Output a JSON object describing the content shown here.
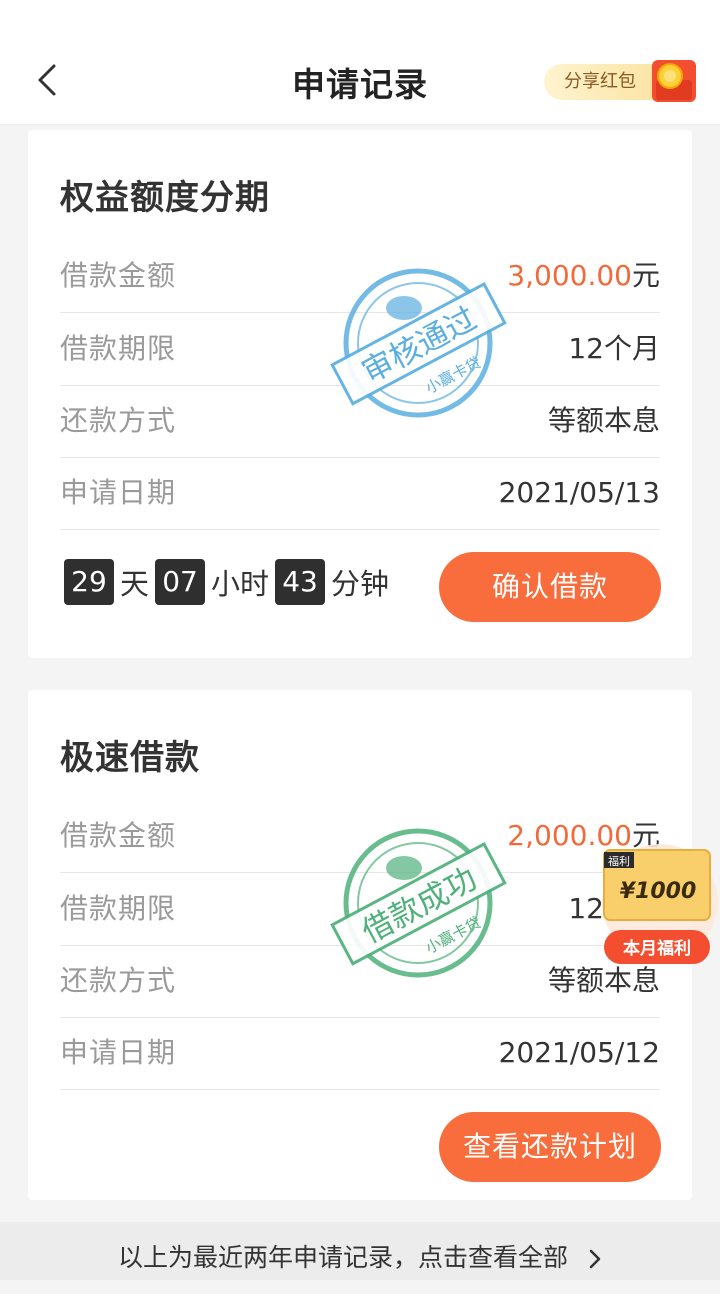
{
  "header": {
    "title": "申请记录",
    "share_label": "分享红包"
  },
  "cards": [
    {
      "title": "权益额度分期",
      "rows": [
        {
          "label": "借款金额",
          "amount": "3,000.00",
          "unit": "元"
        },
        {
          "label": "借款期限",
          "value": "12个月"
        },
        {
          "label": "还款方式",
          "value": "等额本息"
        },
        {
          "label": "申请日期",
          "value": "2021/05/13"
        }
      ],
      "stamp": {
        "main": "审核通过",
        "sub": "小赢卡贷",
        "color": "#5aaee0"
      },
      "countdown": {
        "days": "29",
        "days_unit": "天",
        "hours": "07",
        "hours_unit": "小时",
        "minutes": "43",
        "minutes_unit": "分钟"
      },
      "button": "确认借款"
    },
    {
      "title": "极速借款",
      "rows": [
        {
          "label": "借款金额",
          "amount": "2,000.00",
          "unit": "元"
        },
        {
          "label": "借款期限",
          "value": "12个月"
        },
        {
          "label": "还款方式",
          "value": "等额本息"
        },
        {
          "label": "申请日期",
          "value": "2021/05/12"
        }
      ],
      "stamp": {
        "main": "借款成功",
        "sub": "小赢卡贷",
        "color": "#4eb07a"
      },
      "button": "查看还款计划"
    }
  ],
  "benefit": {
    "tag": "福利",
    "amount": "¥1000",
    "label": "本月福利"
  },
  "footer": {
    "text": "以上为最近两年申请记录，点击查看全部"
  },
  "colors": {
    "accent": "#f96c3c",
    "amount": "#f2693a"
  }
}
